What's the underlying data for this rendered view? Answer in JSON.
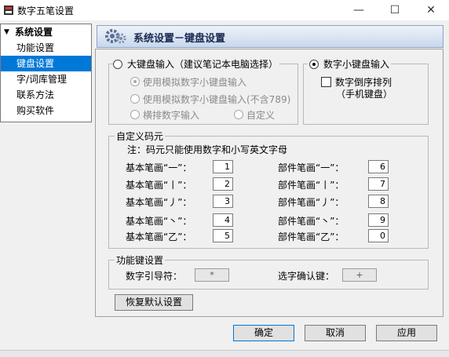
{
  "window": {
    "title": "数字五笔设置",
    "minimize": "—",
    "maximize": "☐",
    "close": "✕"
  },
  "sidebar": {
    "group_label": "系统设置",
    "items": [
      "功能设置",
      "键盘设置",
      "字/词库管理",
      "联系方法",
      "购买软件"
    ],
    "selected": "键盘设置"
  },
  "header": {
    "title": "系统设置－键盘设置"
  },
  "big_keyboard": {
    "label": "大键盘输入（建议笔记本电脑选择）",
    "options": [
      "使用模拟数字小键盘输入",
      "使用模拟数字小键盘输入(不含789)",
      "横排数字输入",
      "自定义"
    ]
  },
  "small_keyboard": {
    "label": "数字小键盘输入",
    "reverse_label": "数字倒序排列",
    "reverse_sub": "（手机键盘）"
  },
  "custom_codes": {
    "label": "自定义码元",
    "note": "注：码元只能使用数字和小写英文字母",
    "basic": [
      {
        "label": "基本笔画“一”：",
        "value": "1"
      },
      {
        "label": "基本笔画“丨”：",
        "value": "2"
      },
      {
        "label": "基本笔画“丿”：",
        "value": "3"
      },
      {
        "label": "基本笔画“丶”：",
        "value": "4"
      },
      {
        "label": "基本笔画“乙”：",
        "value": "5"
      }
    ],
    "parts": [
      {
        "label": "部件笔画“一”：",
        "value": "6"
      },
      {
        "label": "部件笔画“丨”：",
        "value": "7"
      },
      {
        "label": "部件笔画“丿”：",
        "value": "8"
      },
      {
        "label": "部件笔画“丶”：",
        "value": "9"
      },
      {
        "label": "部件笔画“乙”：",
        "value": "0"
      }
    ]
  },
  "function_keys": {
    "label": "功能键设置",
    "guide_label": "数字引导符：",
    "guide_value": "*",
    "confirm_label": "选字确认键：",
    "confirm_value": "+"
  },
  "buttons": {
    "restore": "恢复默认设置",
    "ok": "确定",
    "cancel": "取消",
    "apply": "应用"
  },
  "colors": {
    "selection": "#0078d7",
    "banner": "#c9d8ec"
  }
}
